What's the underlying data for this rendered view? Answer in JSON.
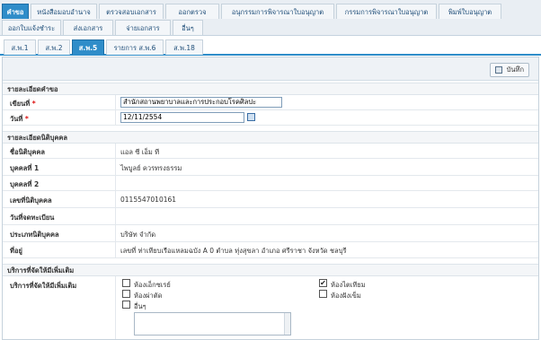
{
  "topnav": {
    "row1": [
      "คำขอ",
      "หนังสือมอบอำนาจ",
      "ตรวจสอบเอกสาร",
      "ออกตรวจ",
      "อนุกรรมการพิจารณาใบอนุญาต",
      "กรรมการพิจารณาใบอนุญาต",
      "พิมพ์ใบอนุญาต"
    ],
    "row2": [
      "ออกใบแจ้งชำระ",
      "ส่งเอกสาร",
      "จ่ายเอกสาร",
      "อื่นๆ"
    ]
  },
  "subtabs": [
    "ส.พ.1",
    "ส.พ.2",
    "ส.พ.5",
    "รายการ ส.พ.6",
    "ส.พ.18"
  ],
  "toolbar": {
    "save_label": "บันทึก"
  },
  "request": {
    "section_title": "รายละเอียดคำขอ",
    "writer_label": "เขียนที่",
    "writer_value": "สำนักสถานพยาบาลและการประกอบโรคศิลปะ",
    "date_label": "วันที่",
    "date_value": "12/11/2554",
    "required_mark": "*"
  },
  "juristic": {
    "section_title": "รายละเอียดนิติบุคคล",
    "rows": [
      {
        "label": "ชื่อนิติบุคคล",
        "value": "แอล ซี เอ็ม ที"
      },
      {
        "label": "บุคคลที่ 1",
        "value": "ไพบูลย์ ควรทรงธรรม"
      },
      {
        "label": "บุคคลที่ 2",
        "value": ""
      },
      {
        "label": "เลขที่นิติบุคคล",
        "value": "0115547010161"
      },
      {
        "label": "วันที่จดทะเบียน",
        "value": ""
      },
      {
        "label": "ประเภทนิติบุคคล",
        "value": "บริษัท จำกัด"
      },
      {
        "label": "ที่อยู่",
        "value": "เลขที่ ท่าเทียบเรือแหลมฉบัง A 0 ตำบล ทุ่งสุขลา อำเภอ ศรีราชา จังหวัด ชลบุรี"
      }
    ]
  },
  "services": {
    "section_title": "บริการที่จัดให้มีเพิ่มเติม",
    "row_label": "บริการที่จัดให้มีเพิ่มเติม",
    "options": [
      {
        "label": "ห้องเอ็กซเรย์",
        "checked": false
      },
      {
        "label": "ห้องไตเทียม",
        "checked": true
      },
      {
        "label": "ห้องผ่าตัด",
        "checked": false
      },
      {
        "label": "ห้องฝังเข็ม",
        "checked": false
      },
      {
        "label": "อื่นๆ",
        "checked": false
      }
    ],
    "check_glyph": "✔"
  }
}
